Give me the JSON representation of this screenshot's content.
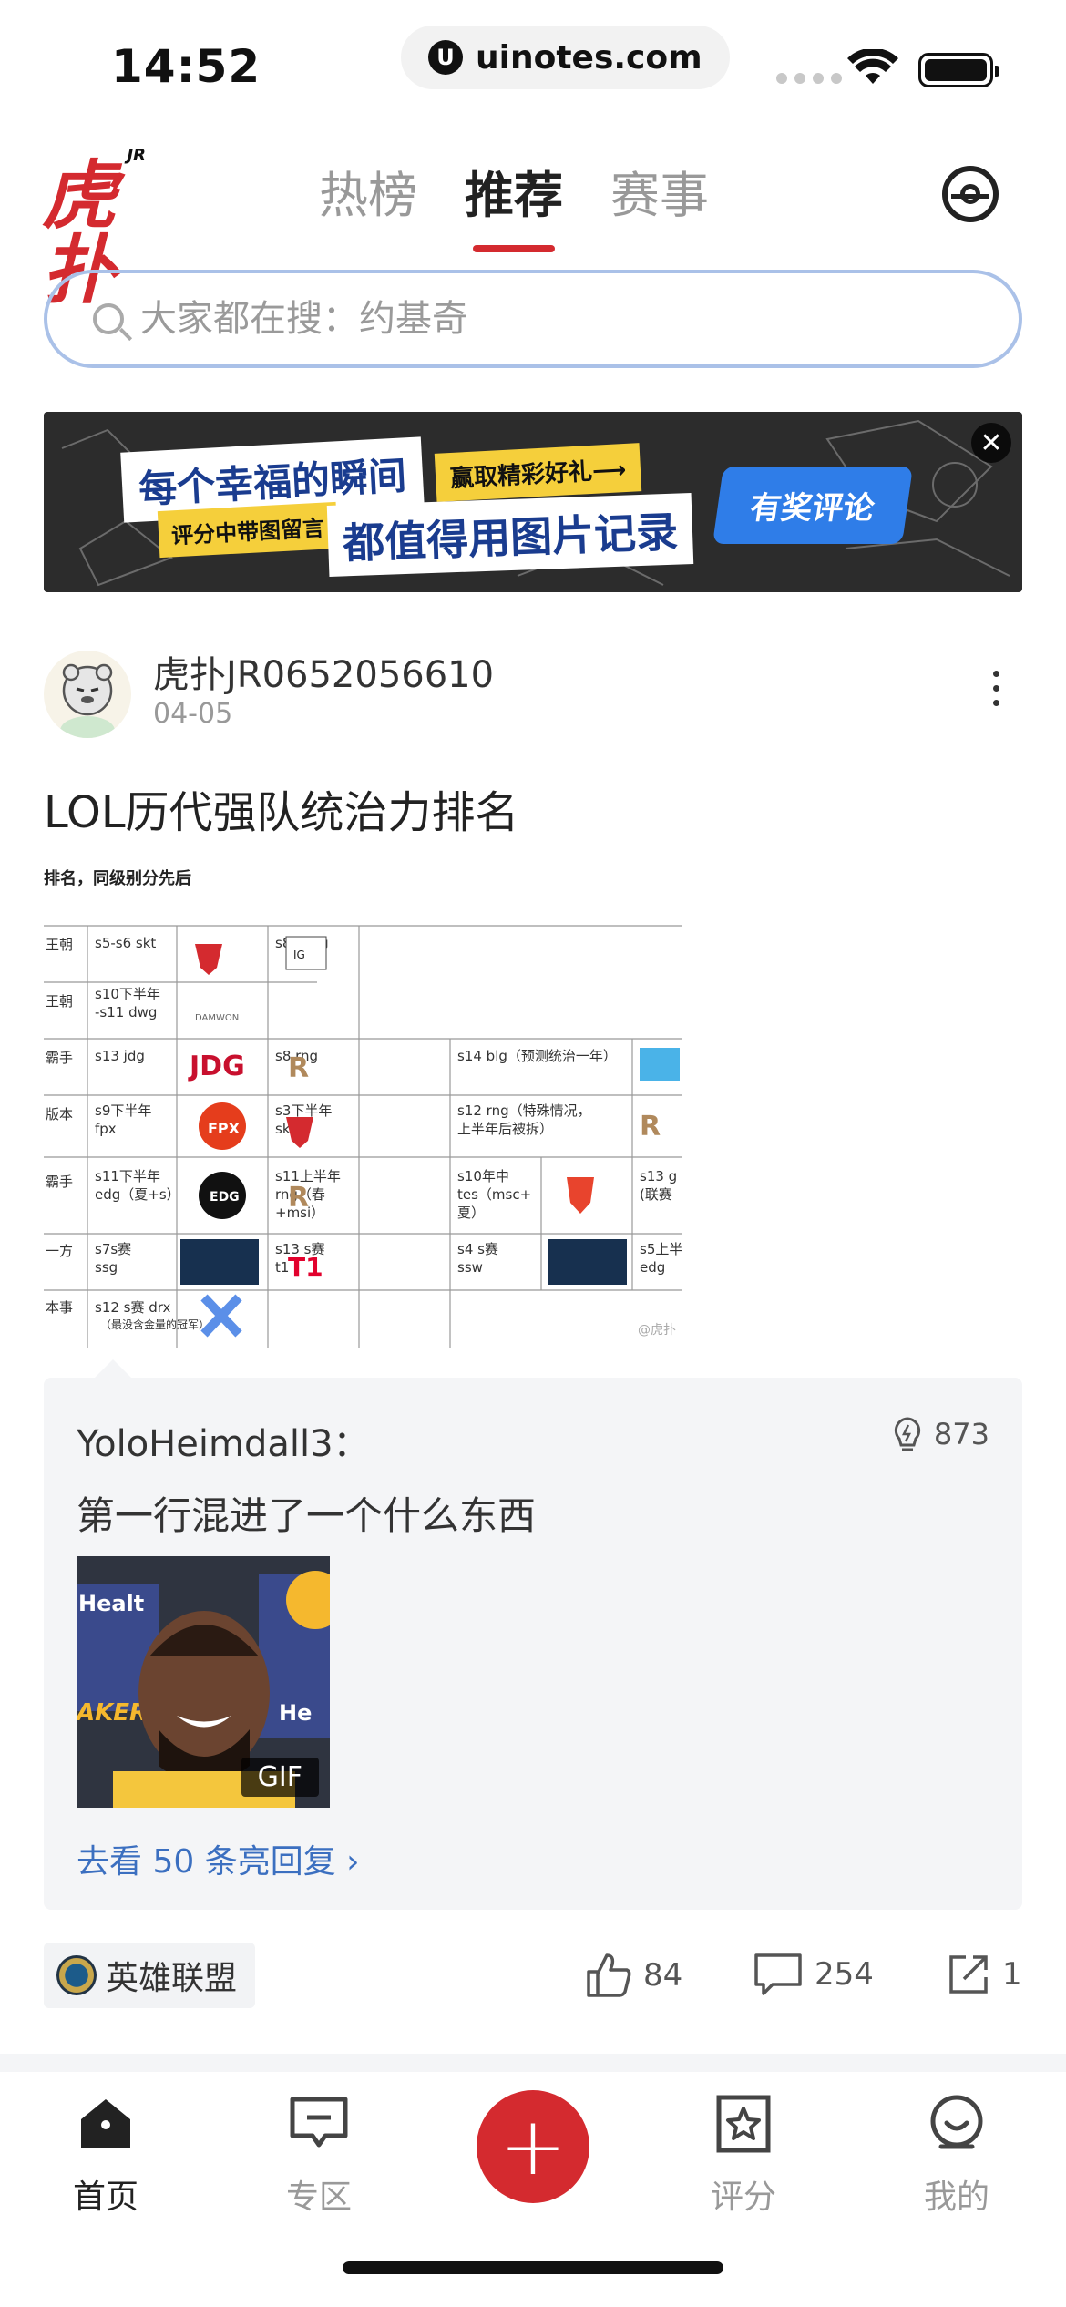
{
  "status_bar": {
    "time": "14:52",
    "url": "uinotes.com"
  },
  "header": {
    "logo_text": "虎扑",
    "logo_badge": "JR",
    "tabs": [
      {
        "label": "热榜",
        "active": false
      },
      {
        "label": "推荐",
        "active": true
      },
      {
        "label": "赛事",
        "active": false
      }
    ]
  },
  "search": {
    "placeholder": "大家都在搜：约基奇"
  },
  "banner": {
    "line1": "每个幸福的瞬间",
    "line2": "赢取精彩好礼⟶",
    "line3": "评分中带图留言",
    "line4": "都值得用图片记录",
    "cta": "有奖评论",
    "close": "✕"
  },
  "post": {
    "author": "虎扑JR0652056610",
    "date": "04-05",
    "title": "LOL历代强队统治力排名",
    "image": {
      "header": "排名，同级别分先后",
      "rows": [
        {
          "tier": "王朝",
          "cells": [
            "s5-s6 skt",
            "",
            "s8-s9 ig",
            ""
          ]
        },
        {
          "tier": "王朝\n(?)",
          "cells": [
            "s10下半年\n-s11 dwg",
            "",
            "",
            ""
          ]
        },
        {
          "tier": "霸手",
          "cells": [
            "s13 jdg",
            "",
            "s8 rng",
            "",
            "s14 blg（预测统治一年）"
          ]
        },
        {
          "tier": "版本",
          "cells": [
            "s9下半年\nfpx",
            "",
            "s3下半年\nskt",
            "",
            "s12 rng（特殊情况，\n上半年后被拆）"
          ]
        },
        {
          "tier": "霸手",
          "cells": [
            "s11下半年\nedg（夏+s）",
            "",
            "s11上半年\nrng（春\n+msi）",
            "",
            "s10年中\ntes（msc+\n夏）",
            "",
            "s13 g\n(联赛"
          ]
        },
        {
          "tier": "一方",
          "cells": [
            "s7s赛\nssg",
            "",
            "s13 s赛\nt1",
            "",
            "s4 s赛\nssw",
            "",
            "s5上半\nedg"
          ]
        },
        {
          "tier": "本事",
          "cells": [
            "s12 s赛 drx\n（最没含金量的冠军）",
            "",
            "",
            ""
          ]
        }
      ],
      "watermark": "@虎扑"
    },
    "hot_comment": {
      "user": "YoloHeimdall3：",
      "likes": "873",
      "text": "第一行混进了一个什么东西",
      "gif_tag": "GIF",
      "gif_sign_left": "Healt",
      "gif_sign_right": "He",
      "gif_lakers": "AKERS",
      "more_link": "去看 50 条亮回复 ›"
    },
    "topic": "英雄联盟",
    "like_count": "84",
    "comment_count": "254",
    "share_count": "1"
  },
  "bottom_nav": {
    "items": [
      {
        "label": "首页",
        "active": true
      },
      {
        "label": "专区",
        "active": false
      },
      {
        "label": "评分",
        "active": false
      },
      {
        "label": "我的",
        "active": false
      }
    ],
    "fab": "+"
  },
  "colors": {
    "brand_red": "#d42a2f",
    "link_blue": "#3b6fc0",
    "search_border": "#aac1e8"
  }
}
